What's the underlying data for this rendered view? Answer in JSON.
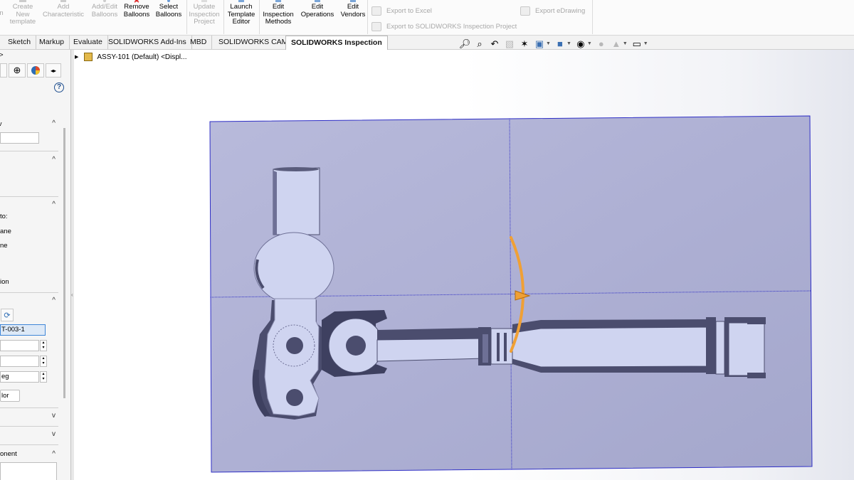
{
  "ribbon": {
    "cut_left": "n",
    "buttons": [
      {
        "id": "create-new-template",
        "label": "Create\nNew\ntemplate",
        "enabled": false
      },
      {
        "id": "add-characteristic",
        "label": "Add\nCharacteristic",
        "enabled": false
      },
      {
        "id": "add-edit-balloons",
        "label": "Add/Edit\nBalloons",
        "enabled": false
      },
      {
        "id": "remove-balloons",
        "label": "Remove\nBalloons",
        "enabled": true
      },
      {
        "id": "select-balloons",
        "label": "Select\nBalloons",
        "enabled": true
      },
      {
        "id": "update-inspection-project",
        "label": "Update\nInspection\nProject",
        "enabled": false
      },
      {
        "id": "launch-template-editor",
        "label": "Launch\nTemplate\nEditor",
        "enabled": true
      },
      {
        "id": "edit-inspection-methods",
        "label": "Edit\nInspection\nMethods",
        "enabled": true
      },
      {
        "id": "edit-operations",
        "label": "Edit\nOperations",
        "enabled": true
      },
      {
        "id": "edit-vendors",
        "label": "Edit\nVendors",
        "enabled": true
      }
    ],
    "export_excel": "Export to Excel",
    "export_project": "Export to SOLIDWORKS Inspection Project",
    "export_edrawing": "Export eDrawing"
  },
  "tabs": [
    {
      "label": "Sketch",
      "active": false
    },
    {
      "label": "Markup",
      "active": false
    },
    {
      "label": "Evaluate",
      "active": false
    },
    {
      "label": "SOLIDWORKS Add-Ins",
      "active": false
    },
    {
      "label": "MBD",
      "active": false
    },
    {
      "label": "SOLIDWORKS CAM",
      "active": false
    },
    {
      "label": "SOLIDWORKS Inspection",
      "active": true
    }
  ],
  "view_toolbar": {
    "icons": [
      "zoom-to-fit-icon",
      "zoom-to-area-icon",
      "previous-view-icon",
      "section-view-icon",
      "dynamic-annotation-icon",
      "view-orientation-icon",
      "display-style-icon",
      "hide-show-items-icon",
      "edit-appearance-icon",
      "apply-scene-icon",
      "view-settings-icon",
      "display-monitor-icon"
    ]
  },
  "property_manager": {
    "top_arrow": ">",
    "help": "?",
    "section1_caret": "^",
    "section2_caret": "^",
    "section3_caret": "^",
    "to_label": "to:",
    "plane_label": "ane",
    "line_label": "ne",
    "option_label": "ion",
    "section4_caret": "^",
    "reference_value": "T-003-1",
    "angle_value": "eg",
    "color_button": "lor",
    "collapsed1_caret": "v",
    "collapsed2_caret": "v",
    "component_label": "onent",
    "component_caret": "^",
    "header_cut_label": "v"
  },
  "tree": {
    "item": "ASSY-101 (Default) <Displ..."
  },
  "colors": {
    "plane_fill": "#b2b4d6",
    "plane_border": "#2f2fc6",
    "part_light": "#cfd4f0",
    "part_dark": "#4b4d6e",
    "rotation_handle": "#f0a035"
  }
}
